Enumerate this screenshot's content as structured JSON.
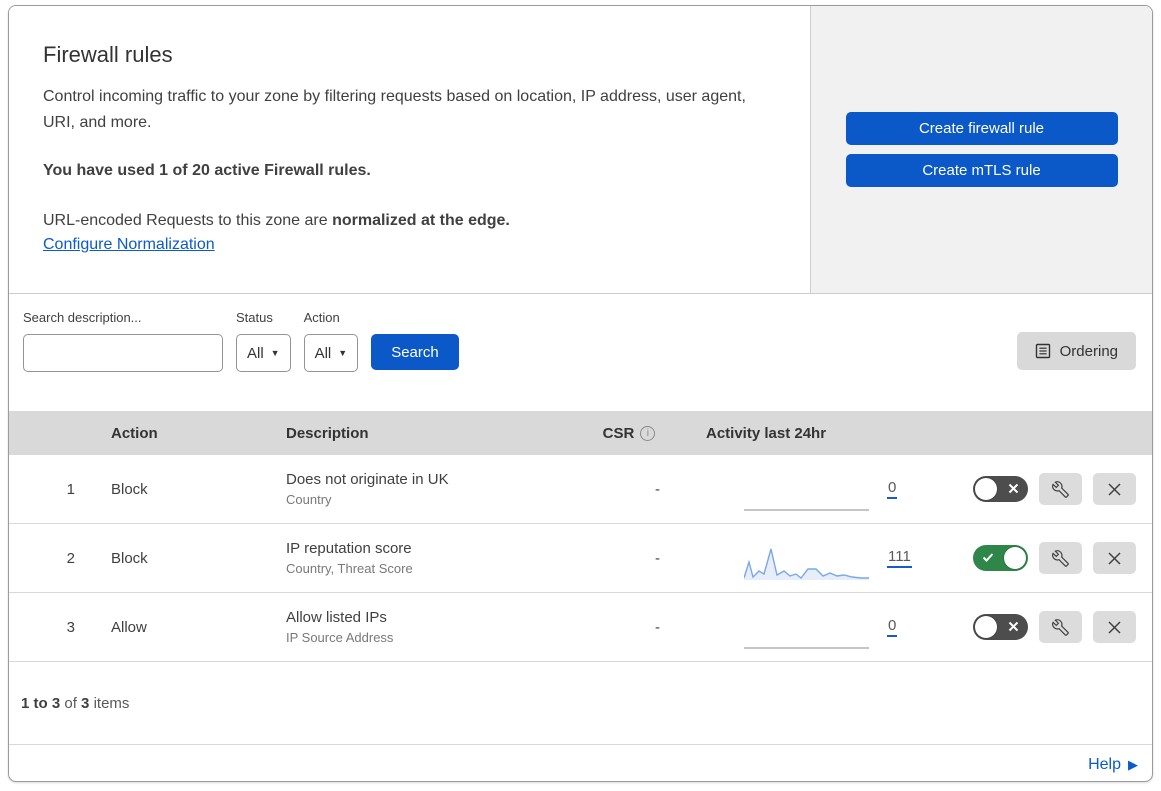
{
  "hero": {
    "title": "Firewall rules",
    "description": "Control incoming traffic to your zone by filtering requests based on location, IP address, user agent, URI, and more.",
    "usage_note": "You have used 1 of 20 active Firewall rules.",
    "normalization_text": "URL-encoded Requests to this zone are",
    "normalization_bold": "normalized at the edge.",
    "normalization_link": "Configure Normalization"
  },
  "side_actions": {
    "create_firewall_rule_label": "Create firewall rule",
    "create_mtls_rule_label": "Create mTLS rule"
  },
  "filters": {
    "search_label": "Search description...",
    "search_value": "",
    "status_label": "Status",
    "status_value": "All",
    "action_label": "Action",
    "action_value": "All",
    "search_button_label": "Search",
    "ordering_button_label": "Ordering"
  },
  "table": {
    "headers": {
      "action": "Action",
      "description": "Description",
      "csr": "CSR",
      "csr_info_icon": "info-icon",
      "activity": "Activity last 24hr"
    },
    "rows": [
      {
        "num": "1",
        "action": "Block",
        "description": "Does not originate in UK",
        "fields": "Country",
        "csr": "-",
        "count": "0",
        "enabled": false
      },
      {
        "num": "2",
        "action": "Block",
        "description": "IP reputation score",
        "fields": "Country, Threat Score",
        "csr": "-",
        "count": "111",
        "enabled": true,
        "sparkline": [
          [
            0,
            2
          ],
          [
            5,
            18
          ],
          [
            9,
            3
          ],
          [
            15,
            9
          ],
          [
            20,
            6
          ],
          [
            27,
            31
          ],
          [
            33,
            5
          ],
          [
            40,
            9
          ],
          [
            46,
            4
          ],
          [
            52,
            6
          ],
          [
            57,
            2
          ],
          [
            64,
            11
          ],
          [
            72,
            11
          ],
          [
            79,
            4
          ],
          [
            86,
            7
          ],
          [
            93,
            4
          ],
          [
            100,
            5
          ],
          [
            108,
            3
          ],
          [
            117,
            2
          ],
          [
            125,
            2
          ]
        ]
      },
      {
        "num": "3",
        "action": "Allow",
        "description": "Allow listed IPs",
        "fields": "IP Source Address",
        "csr": "-",
        "count": "0",
        "enabled": false
      }
    ],
    "summary": {
      "range": "1 to 3",
      "of_word": "of",
      "total": "3",
      "items_word": "items"
    }
  },
  "help_link_label": "Help",
  "colors": {
    "primary_blue": "#0b58c9",
    "link_blue": "#0b5bcb",
    "toggle_on_green": "#2e8648",
    "toggle_off_gray": "#4d4d4d",
    "sparkline_blue": "#7aa7e8",
    "table_header_gray": "#d9d9d9",
    "panel_gray": "#f1f1f1"
  }
}
